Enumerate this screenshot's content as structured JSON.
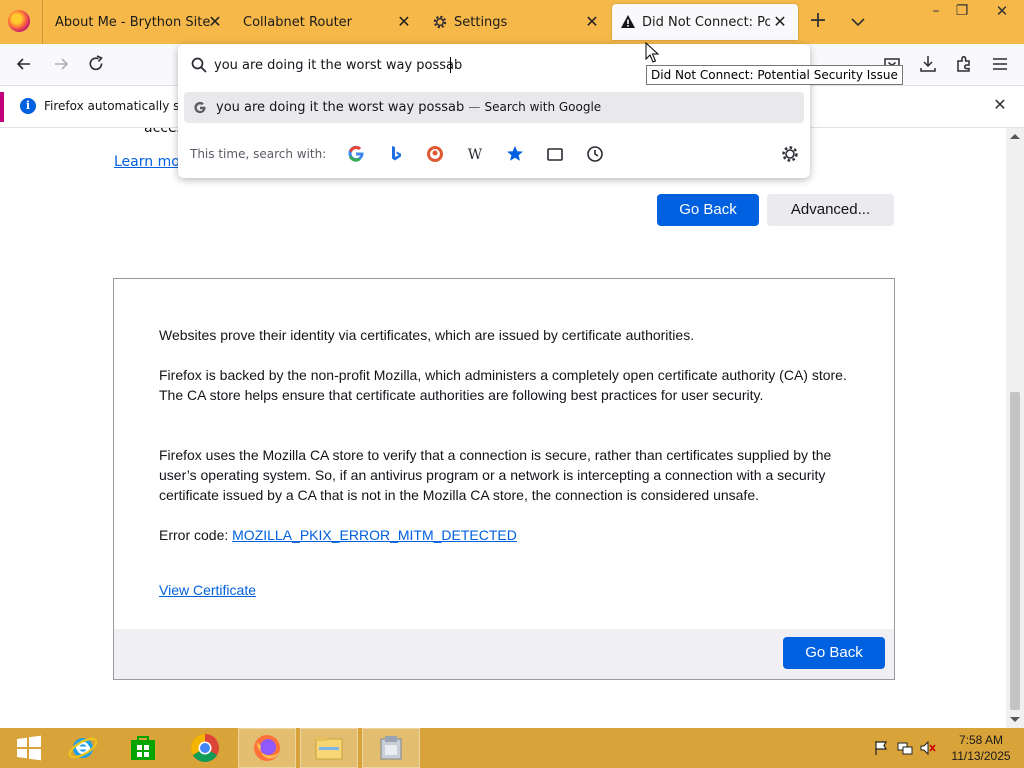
{
  "tabs": [
    {
      "label": "About Me - Brython Site",
      "close": "✕"
    },
    {
      "label": "Collabnet Router",
      "close": "✕"
    },
    {
      "label": "Settings",
      "icon": "gear-icon",
      "close": "✕"
    },
    {
      "label": "Did Not Connect: Poten",
      "icon": "warning-icon",
      "close": "✕",
      "active": true
    }
  ],
  "tabstrip": {
    "new_tab": "+",
    "minimize": "–",
    "restore": "❐",
    "close": "✕"
  },
  "urlbar": {
    "value": "you are doing it the worst way possab",
    "suggestion_text": "you are doing it the worst way possab",
    "suggestion_dash": "—",
    "suggestion_action": "Search with Google",
    "one_off_label": "This time, search with:",
    "engines": [
      "google-icon",
      "bing-icon",
      "duckduckgo-icon",
      "wikipedia-icon",
      "bookmarks-icon",
      "tabs-icon",
      "history-icon"
    ],
    "wikipedia_glyph": "W"
  },
  "tooltip": "Did Not Connect: Potential Security Issue",
  "notification": {
    "text": "Firefox automatically sen",
    "info_glyph": "i",
    "close": "✕"
  },
  "page": {
    "access_fragment": "acces",
    "learn_more": "Learn mo",
    "go_back": "Go Back",
    "advanced": "Advanced...",
    "p1": "Websites prove their identity via certificates, which are issued by certificate authorities.",
    "p2": "Firefox is backed by the non-profit Mozilla, which administers a completely open certificate authority (CA) store. The CA store helps ensure that certificate authorities are following best practices for user security.",
    "p3": "Firefox uses the Mozilla CA store to verify that a connection is secure, rather than certificates supplied by the user’s operating system. So, if an antivirus program or a network is intercepting a connection with a security certificate issued by a CA that is not in the Mozilla CA store, the connection is considered unsafe.",
    "error_label": "Error code: ",
    "error_code": "MOZILLA_PKIX_ERROR_MITM_DETECTED",
    "view_certificate": "View Certificate",
    "go_back_bottom": "Go Back"
  },
  "taskbar": {
    "apps": [
      "windows-start-icon",
      "internet-explorer-icon",
      "store-icon",
      "chrome-icon",
      "firefox-icon",
      "file-explorer-icon",
      "app-icon"
    ],
    "time": "7:58 AM",
    "date": "11/13/2025"
  },
  "colors": {
    "tabstrip": "#f5b849",
    "taskbar": "#d8a43a",
    "accent": "#0061e0",
    "link": "#0060df"
  }
}
